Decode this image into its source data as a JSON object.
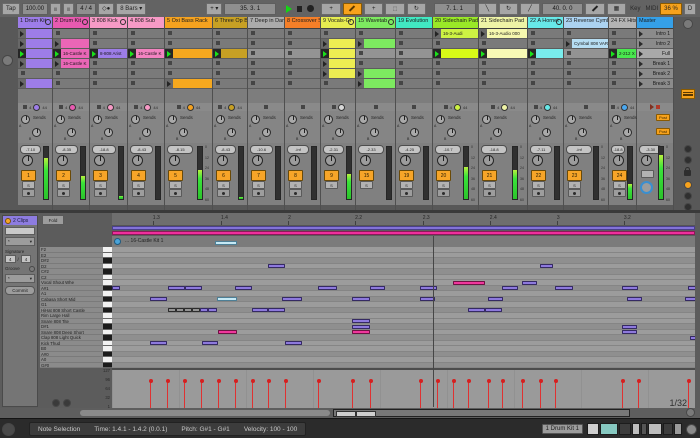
{
  "transport": {
    "tap": "Tap",
    "tempo": "100.00",
    "nudge_down": "|||",
    "nudge_up": "|||",
    "time_sig": "4 / 4",
    "metronome": "◇●",
    "quantize": "8 Bars",
    "position": "35. 3. 1",
    "loop_start": "7. 1. 1",
    "loop_length": "40. 0. 0",
    "key_label": "Key",
    "midi_label": "MIDI",
    "cpu": "36 %",
    "disk": "D"
  },
  "session": {
    "sends_label": "Sends",
    "send_a": "A",
    "send_b": "B",
    "post_label": "Post",
    "solo_label": "S",
    "meter_scale": [
      "0",
      "12",
      "24",
      "36",
      "48",
      "60"
    ],
    "status_left": "4",
    "status_right": "44",
    "tracks": [
      {
        "id": "1",
        "name": "1 Drum Kit",
        "color": "#9d7de8",
        "group": true,
        "status": "full",
        "dot": "#9d7de8",
        "slots": [
          {
            "k": "clip",
            "c": "#9d7de8"
          },
          {
            "k": "clip",
            "c": "#9d7de8"
          },
          {
            "k": "clip",
            "c": "#9d7de8",
            "p": true
          },
          {
            "k": "clip",
            "c": "#9d7de8"
          },
          {
            "k": "stop"
          },
          {
            "k": "clip",
            "c": "#9d7de8"
          }
        ],
        "mixer": {
          "db": "-7.10",
          "meter": 78,
          "arm": true
        }
      },
      {
        "id": "2",
        "name": "2 Drum Kit",
        "color": "#e85ab0",
        "group": true,
        "status": "full",
        "dot": "#e85ab0",
        "slots": [
          {
            "k": "stop"
          },
          {
            "k": "clip",
            "c": "#ea66b6"
          },
          {
            "k": "clip",
            "c": "#ea66b6",
            "l": "16-Castle K",
            "p": true
          },
          {
            "k": "clip",
            "c": "#ea66b6",
            "l": "16-Castle K"
          },
          {
            "k": "stop"
          },
          {
            "k": "stop"
          }
        ],
        "mixer": {
          "db": "-8.35",
          "meter": 45,
          "arm": true
        }
      },
      {
        "id": "3",
        "name": "3 808 Kick",
        "color": "#f79ac6",
        "group": true,
        "status": "full",
        "dot": "#f79ac6",
        "slots": [
          {
            "k": "stop"
          },
          {
            "k": "stop"
          },
          {
            "k": "clip",
            "c": "#9d7de8",
            "l": "8-808 Arist",
            "p": true
          },
          {
            "k": "stop"
          },
          {
            "k": "stop"
          },
          {
            "k": "stop"
          }
        ],
        "mixer": {
          "db": "-18.8",
          "meter": 6,
          "arm": true
        }
      },
      {
        "id": "4",
        "name": "4 808 Sub",
        "color": "#f79ac6",
        "status": "full",
        "dot": "#f79ac6",
        "slots": [
          {
            "k": "stop"
          },
          {
            "k": "stop"
          },
          {
            "k": "clip",
            "c": "#f383c0",
            "l": "16-Castle K",
            "p": true
          },
          {
            "k": "stop"
          },
          {
            "k": "stop"
          },
          {
            "k": "stop"
          }
        ],
        "mixer": {
          "db": "-8.43",
          "meter": 0,
          "arm": true
        }
      },
      {
        "id": "5",
        "name": "5 Oxi Bass Rack",
        "color": "#f5a21f",
        "status": "full",
        "dot": "#f5a21f",
        "slots": [
          {
            "k": "stop"
          },
          {
            "k": "stop"
          },
          {
            "k": "clip",
            "c": "#f5a81f",
            "p": true
          },
          {
            "k": "stop"
          },
          {
            "k": "stop"
          },
          {
            "k": "clip",
            "c": "#f5a81f"
          }
        ],
        "mixer": {
          "db": "-8.15",
          "meter": 55,
          "arm": true,
          "scale": true
        }
      },
      {
        "id": "6",
        "name": "6 Three Op Ba",
        "color": "#c7a024",
        "status": "full",
        "dot": "#c7a024",
        "slots": [
          {
            "k": "stop"
          },
          {
            "k": "stop"
          },
          {
            "k": "clip",
            "c": "#c7a024",
            "p": true
          },
          {
            "k": "stop"
          },
          {
            "k": "stop"
          },
          {
            "k": "stop"
          }
        ],
        "mixer": {
          "db": "-8.43",
          "meter": 4,
          "arm": true
        }
      },
      {
        "id": "7",
        "name": "7 Deep in Dark",
        "color": "#ababab",
        "status": "min",
        "slots": [
          {
            "k": "stop"
          },
          {
            "k": "stop"
          },
          {
            "k": "stop"
          },
          {
            "k": "stop"
          },
          {
            "k": "stop"
          },
          {
            "k": "stop"
          }
        ],
        "mixer": {
          "db": "-10.6",
          "meter": 0,
          "arm": true
        }
      },
      {
        "id": "8",
        "name": "8 Crossover Sy",
        "color": "#f57f28",
        "status": "min",
        "slots": [
          {
            "k": "stop"
          },
          {
            "k": "stop"
          },
          {
            "k": "stop"
          },
          {
            "k": "stop"
          },
          {
            "k": "stop"
          },
          {
            "k": "stop"
          }
        ],
        "mixer": {
          "db": "-inf",
          "meter": 0,
          "arm": true
        }
      },
      {
        "id": "9",
        "name": "9 Vocals-Gr",
        "color": "#e6ec50",
        "group": true,
        "status": "circle",
        "slots": [
          {
            "k": "stop"
          },
          {
            "k": "clip",
            "c": "#eded52",
            "h": true
          },
          {
            "k": "clip",
            "c": "#eded52",
            "h": true,
            "p": true
          },
          {
            "k": "clip",
            "c": "#eded52",
            "h": true
          },
          {
            "k": "clip",
            "c": "#eded52",
            "h": true
          },
          {
            "k": "stop"
          }
        ],
        "mixer": {
          "db": "-2.31",
          "meter": 48,
          "arm": false
        }
      },
      {
        "id": "15",
        "name": "15 Wavetab",
        "color": "#7dea60",
        "group": true,
        "status": "min",
        "slots": [
          {
            "k": "stop"
          },
          {
            "k": "clip",
            "c": "#7dea60",
            "h": true
          },
          {
            "k": "stop"
          },
          {
            "k": "stop"
          },
          {
            "k": "clip",
            "c": "#7dea60",
            "h": true
          },
          {
            "k": "clip",
            "c": "#7dea60",
            "h": true
          }
        ],
        "mixer": {
          "db": "-2.33",
          "meter": 0,
          "arm": false
        }
      },
      {
        "id": "19",
        "name": "19 Evolution",
        "color": "#41e8c2",
        "status": "min",
        "slots": [
          {
            "k": "stop"
          },
          {
            "k": "stop"
          },
          {
            "k": "stop"
          },
          {
            "k": "stop"
          },
          {
            "k": "stop"
          },
          {
            "k": "stop"
          }
        ],
        "mixer": {
          "db": "-4.25",
          "meter": 0,
          "arm": true
        }
      },
      {
        "id": "20",
        "name": "20 Sidechain Pad",
        "color": "#9ae827",
        "status": "full",
        "dot": "#cdf243",
        "slots": [
          {
            "k": "clip",
            "c": "#cdf243",
            "l": "16-3-Audi"
          },
          {
            "k": "stop"
          },
          {
            "k": "clip",
            "c": "#d8fa17",
            "p": true
          },
          {
            "k": "stop"
          },
          {
            "k": "stop"
          },
          {
            "k": "stop"
          }
        ],
        "mixer": {
          "db": "-10.7",
          "meter": 62,
          "arm": true,
          "scale": true
        }
      },
      {
        "id": "21",
        "name": "21 Sidechain Pad",
        "color": "#eef3a6",
        "status": "full",
        "dot": "#eef3a6",
        "slots": [
          {
            "k": "clip",
            "c": "#f5f7ae",
            "l": "16-3-Audio 000"
          },
          {
            "k": "stop"
          },
          {
            "k": "clip",
            "c": "#f7f9b5",
            "p": true
          },
          {
            "k": "stop"
          },
          {
            "k": "stop"
          },
          {
            "k": "stop"
          }
        ],
        "mixer": {
          "db": "-18.8",
          "meter": 56,
          "arm": true,
          "scale": true
        }
      },
      {
        "id": "22",
        "name": "22 A Hornet",
        "color": "#67e8e8",
        "group": true,
        "status": "full",
        "dot": "#67e8e8",
        "slots": [
          {
            "k": "stop"
          },
          {
            "k": "stop"
          },
          {
            "k": "clip",
            "c": "#79eded",
            "p": true
          },
          {
            "k": "stop"
          },
          {
            "k": "stop"
          },
          {
            "k": "stop"
          }
        ],
        "mixer": {
          "db": "-7.11",
          "meter": 0,
          "arm": true
        }
      },
      {
        "id": "23",
        "name": "23 Reverse Cymbal",
        "color": "#abd2f0",
        "status": "min",
        "slots": [
          {
            "k": "stop"
          },
          {
            "k": "clip",
            "c": "#b7def3",
            "l": "Cymbal 808 VAR"
          },
          {
            "k": "stop"
          },
          {
            "k": "stop"
          },
          {
            "k": "stop"
          },
          {
            "k": "stop"
          }
        ],
        "mixer": {
          "db": "-inf",
          "meter": 0,
          "arm": true,
          "scale": true
        }
      },
      {
        "id": "24",
        "name": "24 FX Hits",
        "color": "#b3b3b3",
        "status": "full",
        "dot": "#4aa8f0",
        "slots": [
          {
            "k": "stop"
          },
          {
            "k": "stop"
          },
          {
            "k": "clip",
            "c": "#49e84e",
            "l": "2-212 X",
            "p": true
          },
          {
            "k": "stop"
          },
          {
            "k": "stop"
          },
          {
            "k": "stop"
          }
        ],
        "mixer": {
          "db": "-18.8",
          "meter": 28,
          "arm": true
        }
      },
      {
        "id": "M",
        "name": "Master",
        "color": "#35a0e8",
        "status": "master",
        "slots": [
          {
            "k": "scene",
            "l": "Intro 1"
          },
          {
            "k": "scene",
            "l": "Intro 2"
          },
          {
            "k": "scene",
            "l": "Full",
            "sel": true
          },
          {
            "k": "scene",
            "l": "Break 1"
          },
          {
            "k": "scene",
            "l": "Break 2"
          },
          {
            "k": "scene",
            "l": "Break 3"
          }
        ],
        "mixer": {
          "db": "-3.30",
          "meter": 85,
          "arm": false,
          "scale": true
        }
      }
    ]
  },
  "clip_panel": {
    "title": "2 Clips",
    "star": "*",
    "signature_label": "Signature",
    "sig_num": "4",
    "sig_slash": "/",
    "sig_den": "4",
    "groove_label": "Groove",
    "commit": "Commit"
  },
  "piano_roll": {
    "fold_label": "Fold",
    "clip_title": "... 16-Castle Kit 1",
    "grid_label": "1/32",
    "ruler": [
      {
        "l": "1.3",
        "p": 7.0
      },
      {
        "l": "1.4",
        "p": 18.7
      },
      {
        "l": "2",
        "p": 30.2
      },
      {
        "l": "2.2",
        "p": 41.7
      },
      {
        "l": "2.3",
        "p": 53.3
      },
      {
        "l": "2.4",
        "p": 64.8
      },
      {
        "l": "3",
        "p": 76.3
      },
      {
        "l": "3.2",
        "p": 87.8
      }
    ],
    "keys": [
      {
        "n": "F2"
      },
      {
        "n": "E2"
      },
      {
        "n": "D#2",
        "b": true
      },
      {
        "n": "D2"
      },
      {
        "n": "C#2",
        "b": true
      },
      {
        "n": "C2"
      },
      {
        "n": "Vocal Shout Whe"
      },
      {
        "n": "A#1",
        "b": true
      },
      {
        "n": "A1"
      },
      {
        "n": "Cabasa Short Mid",
        "b": true
      },
      {
        "n": "G1"
      },
      {
        "n": "HiHat 808 Short Castle",
        "b": true
      },
      {
        "n": "Rim Large Hall"
      },
      {
        "n": "Snare 808 Tite"
      },
      {
        "n": "D#1",
        "b": true
      },
      {
        "n": "Snare 808 Deep Short"
      },
      {
        "n": "Clap 808 Light Quick",
        "b": true
      },
      {
        "n": "Kick Thud"
      },
      {
        "n": "B0"
      },
      {
        "n": "A#0",
        "b": true
      },
      {
        "n": "A0"
      },
      {
        "n": "G#0",
        "b": true
      }
    ],
    "notes": [
      [
        3,
        268,
        17,
        0
      ],
      [
        3,
        540,
        13,
        0
      ],
      [
        6,
        453,
        32,
        1
      ],
      [
        6,
        522,
        15,
        0
      ],
      [
        7,
        112,
        8,
        0
      ],
      [
        7,
        168,
        17,
        0
      ],
      [
        7,
        185,
        17,
        0
      ],
      [
        7,
        235,
        17,
        0
      ],
      [
        7,
        318,
        19,
        0
      ],
      [
        7,
        370,
        15,
        0
      ],
      [
        7,
        420,
        17,
        0
      ],
      [
        7,
        502,
        16,
        0
      ],
      [
        7,
        555,
        18,
        0
      ],
      [
        7,
        622,
        16,
        0
      ],
      [
        7,
        688,
        12,
        0
      ],
      [
        9,
        150,
        17,
        0
      ],
      [
        9,
        217,
        20,
        3
      ],
      [
        9,
        282,
        20,
        0
      ],
      [
        9,
        352,
        18,
        0
      ],
      [
        9,
        420,
        15,
        0
      ],
      [
        9,
        488,
        15,
        0
      ],
      [
        9,
        627,
        15,
        0
      ],
      [
        9,
        685,
        15,
        0
      ],
      [
        11,
        168,
        8,
        2
      ],
      [
        11,
        176,
        8,
        2
      ],
      [
        11,
        184,
        8,
        2
      ],
      [
        11,
        192,
        8,
        2
      ],
      [
        11,
        200,
        8,
        0
      ],
      [
        11,
        208,
        9,
        0
      ],
      [
        11,
        252,
        16,
        0
      ],
      [
        11,
        268,
        17,
        0
      ],
      [
        11,
        468,
        17,
        0
      ],
      [
        11,
        485,
        17,
        0
      ],
      [
        13,
        352,
        18,
        0
      ],
      [
        14,
        352,
        18,
        0
      ],
      [
        14,
        622,
        15,
        0
      ],
      [
        15,
        218,
        19,
        1
      ],
      [
        15,
        352,
        18,
        1
      ],
      [
        15,
        622,
        15,
        0
      ],
      [
        16,
        690,
        8,
        0
      ],
      [
        17,
        150,
        17,
        0
      ],
      [
        17,
        202,
        16,
        0
      ],
      [
        17,
        285,
        17,
        0
      ]
    ],
    "velocity": {
      "labels": [
        "127",
        "96",
        "64",
        "32",
        "1"
      ],
      "value": 100,
      "stems": [
        150,
        167,
        184,
        201,
        218,
        235,
        252,
        268,
        285,
        318,
        352,
        370,
        420,
        437,
        453,
        468,
        488,
        502,
        522,
        540,
        555,
        622,
        638,
        688
      ]
    }
  },
  "status_bar": {
    "mode": "Note Selection",
    "time": "Time: 1.4.1 - 1.4.2 (0.0.1)",
    "pitch": "Pitch: G#1 - G#1",
    "velocity": "Velocity: 100 - 100",
    "device": "1 Drum Kit 1"
  },
  "colors": {
    "accent_green": "#1ae21a",
    "selection_blue": "#c6e9f5",
    "note_purple": "#8d79dd",
    "note_pink": "#f0379d",
    "meter_green": "#3ae43a",
    "velocity_red": "#e03131",
    "ribbon_purple": "#8272d8",
    "ribbon_pink": "#ef2f9d",
    "master_blue": "#35a0e8",
    "cpu_orange": "#f7a21c"
  }
}
